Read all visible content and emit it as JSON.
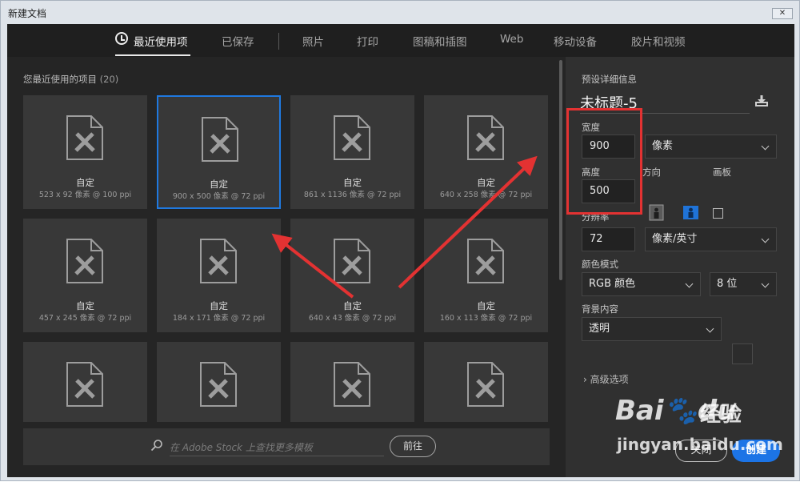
{
  "window": {
    "title": "新建文档",
    "close_glyph": "✕"
  },
  "tabs": [
    {
      "label": "最近使用项",
      "active": true
    },
    {
      "label": "已保存"
    },
    {
      "label": "照片"
    },
    {
      "label": "打印"
    },
    {
      "label": "图稿和插图"
    },
    {
      "label": "Web"
    },
    {
      "label": "移动设备"
    },
    {
      "label": "胶片和视频"
    }
  ],
  "recent": {
    "label": "您最近使用的项目",
    "count": "(20)",
    "items": [
      {
        "name": "自定",
        "size": "523 x 92 像素 @ 100 ppi"
      },
      {
        "name": "自定",
        "size": "900 x 500 像素 @ 72 ppi",
        "selected": true
      },
      {
        "name": "自定",
        "size": "861 x 1136 像素 @ 72 ppi"
      },
      {
        "name": "自定",
        "size": "640 x 258 像素 @ 72 ppi"
      },
      {
        "name": "自定",
        "size": "457 x 245 像素 @ 72 ppi"
      },
      {
        "name": "自定",
        "size": "184 x 171 像素 @ 72 ppi"
      },
      {
        "name": "自定",
        "size": "640 x 43 像素 @ 72 ppi"
      },
      {
        "name": "自定",
        "size": "160 x 113 像素 @ 72 ppi"
      },
      {
        "name": "",
        "size": ""
      },
      {
        "name": "",
        "size": ""
      },
      {
        "name": "",
        "size": ""
      },
      {
        "name": "",
        "size": ""
      }
    ]
  },
  "search": {
    "placeholder": "在 Adobe Stock 上查找更多模板",
    "go_label": "前往"
  },
  "preset": {
    "header": "预设详细信息",
    "doc_title": "未标题-5",
    "width_label": "宽度",
    "width_value": "900",
    "unit": "像素",
    "height_label": "高度",
    "height_value": "500",
    "orientation_label": "方向",
    "artboard_label": "画板",
    "resolution_label": "分辨率",
    "resolution_value": "72",
    "resolution_unit": "像素/英寸",
    "color_mode_label": "颜色模式",
    "color_mode": "RGB 颜色",
    "bit_depth": "8 位",
    "background_label": "背景内容",
    "background": "透明",
    "advanced_label": "高级选项",
    "close_label": "关闭",
    "create_label": "创建"
  },
  "colors": {
    "accent": "#1c74e6",
    "annotation": "#e33232",
    "bg_dark": "#252525"
  },
  "watermark": {
    "brand": "Bai",
    "brand2": "du",
    "site": "经验",
    "url": "jingyan.baidu.com"
  }
}
